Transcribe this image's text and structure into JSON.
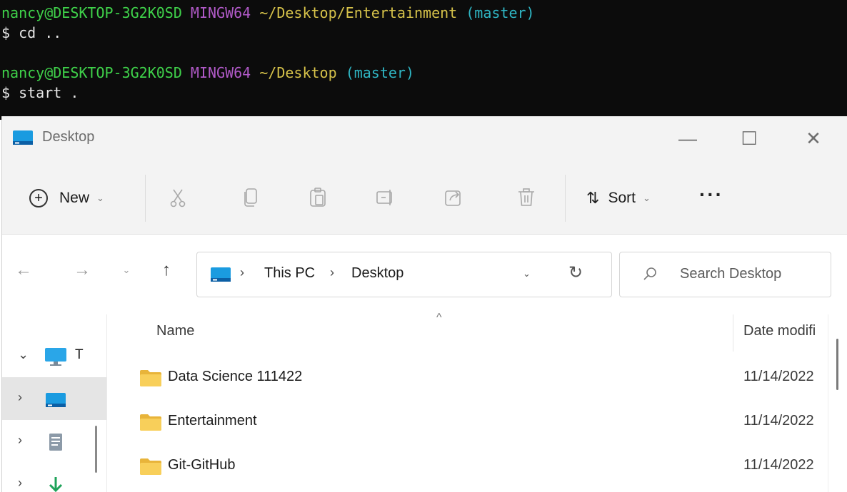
{
  "terminal": {
    "lines": [
      {
        "user": "nancy@DESKTOP-3G2K0SD",
        "env": "MINGW64",
        "path": "~/Desktop/Entertainment",
        "branch": "(master)"
      },
      {
        "cmd": "$ cd .."
      },
      {
        "user": "nancy@DESKTOP-3G2K0SD",
        "env": "MINGW64",
        "path": "~/Desktop",
        "branch": "(master)"
      },
      {
        "cmd": "$ start ."
      }
    ]
  },
  "window": {
    "title": "Desktop",
    "controls": {
      "minimize": "—",
      "maximize": "☐",
      "close": "✕"
    }
  },
  "toolbar": {
    "new_label": "New",
    "sort_label": "Sort",
    "more_label": "···",
    "icons": [
      "cut-icon",
      "copy-icon",
      "paste-icon",
      "rename-icon",
      "share-icon",
      "delete-icon"
    ]
  },
  "nav": {
    "breadcrumb": [
      "This PC",
      "Desktop"
    ],
    "search_placeholder": "Search Desktop"
  },
  "sidebar": {
    "items": [
      {
        "label": "T",
        "chevron": "⌄",
        "icon": "this-pc-icon"
      },
      {
        "label": "",
        "chevron": "›",
        "icon": "desktop-icon",
        "selected": true
      },
      {
        "label": "",
        "chevron": "›",
        "icon": "documents-icon"
      },
      {
        "label": "",
        "chevron": "›",
        "icon": "downloads-icon"
      }
    ]
  },
  "filelist": {
    "columns": {
      "name": "Name",
      "date": "Date modifi"
    },
    "rows": [
      {
        "name": "Data Science 111422",
        "date": "11/14/2022"
      },
      {
        "name": "Entertainment",
        "date": "11/14/2022"
      },
      {
        "name": "Git-GitHub",
        "date": "11/14/2022"
      }
    ]
  },
  "colors": {
    "terminal_bg": "#0c0c0c",
    "user": "#3fd14a",
    "env": "#b15ac8",
    "path": "#d6c24a",
    "branch": "#2fb6c4",
    "folder": "#f2c44b",
    "selected_row": "#e5e5e5"
  }
}
